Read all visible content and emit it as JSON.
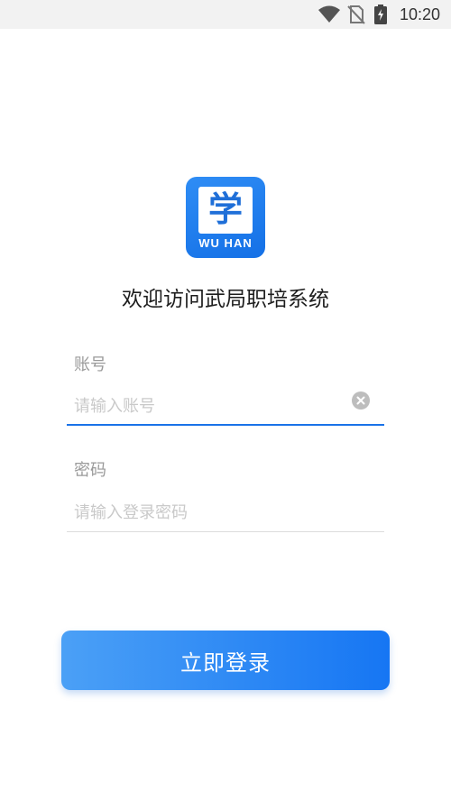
{
  "status_bar": {
    "time": "10:20",
    "icons": [
      "wifi-icon",
      "no-sim-icon",
      "battery-charging-icon"
    ]
  },
  "logo": {
    "char": "学",
    "text": "WU HAN"
  },
  "welcome_title": "欢迎访问武局职培系统",
  "account": {
    "label": "账号",
    "placeholder": "请输入账号",
    "value": ""
  },
  "password": {
    "label": "密码",
    "placeholder": "请输入登录密码",
    "value": ""
  },
  "login_button": {
    "label": "立即登录"
  },
  "colors": {
    "accent": "#1a73e8",
    "button_gradient_start": "#4ba0f6",
    "button_gradient_end": "#1676f3",
    "logo_bg": "#1f7ef0"
  }
}
